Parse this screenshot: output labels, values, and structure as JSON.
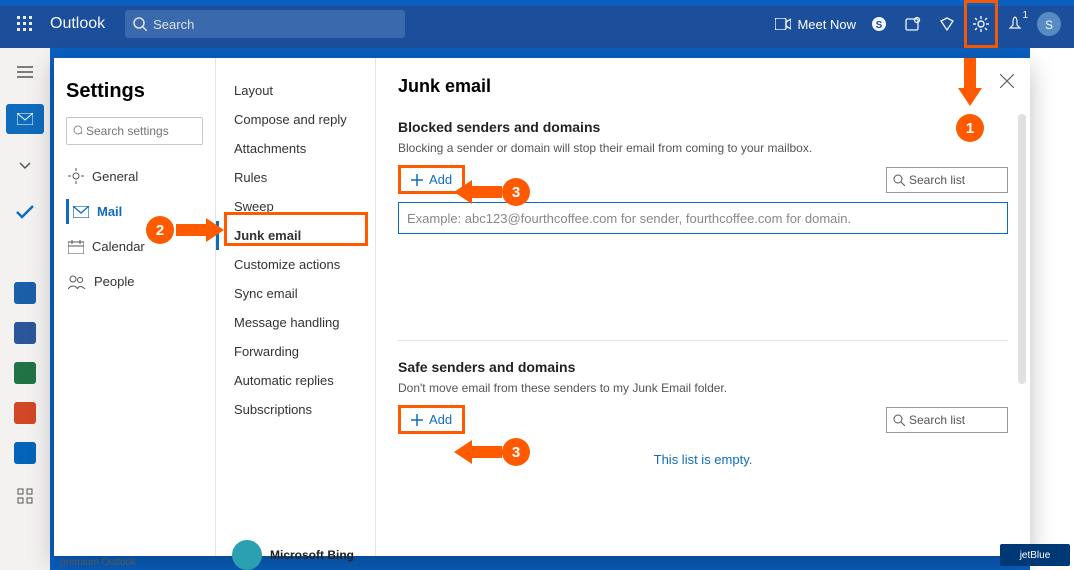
{
  "header": {
    "brand": "Outlook",
    "search_placeholder": "Search",
    "meet_now": "Meet Now",
    "notification_count": "1"
  },
  "settings": {
    "title": "Settings",
    "search_placeholder": "Search settings",
    "categories": [
      {
        "label": "General"
      },
      {
        "label": "Mail"
      },
      {
        "label": "Calendar"
      },
      {
        "label": "People"
      }
    ],
    "mail_subsections": [
      "Layout",
      "Compose and reply",
      "Attachments",
      "Rules",
      "Sweep",
      "Junk email",
      "Customize actions",
      "Sync email",
      "Message handling",
      "Forwarding",
      "Automatic replies",
      "Subscriptions"
    ]
  },
  "junk": {
    "title": "Junk email",
    "blocked": {
      "heading": "Blocked senders and domains",
      "desc": "Blocking a sender or domain will stop their email from coming to your mailbox.",
      "add": "Add",
      "search_placeholder": "Search list",
      "input_placeholder": "Example: abc123@fourthcoffee.com for sender, fourthcoffee.com for domain."
    },
    "safe": {
      "heading": "Safe senders and domains",
      "desc": "Don't move email from these senders to my Junk Email folder.",
      "add": "Add",
      "search_placeholder": "Search list",
      "empty": "This list is empty."
    }
  },
  "annotations": {
    "n1": "1",
    "n2": "2",
    "n3a": "3",
    "n3b": "3"
  },
  "background": {
    "premium": "premium Outlook",
    "bing": "Microsoft Bing",
    "jetblue": "jetBlue"
  }
}
